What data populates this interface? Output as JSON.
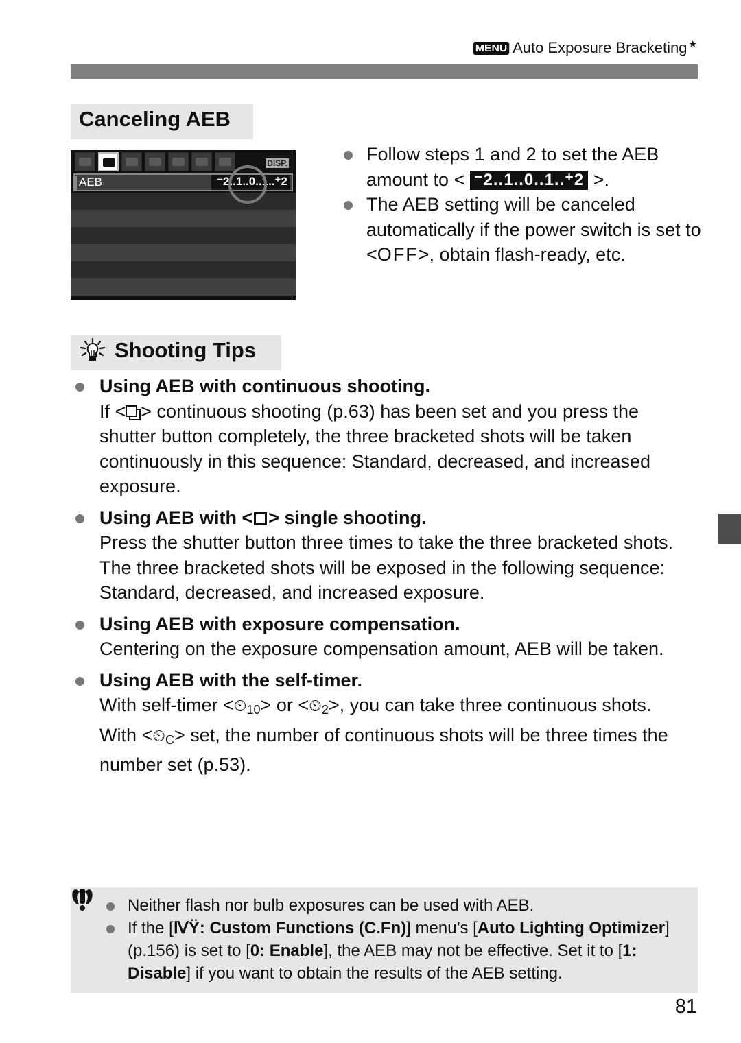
{
  "header": {
    "menu_badge": "MENU",
    "section_title": "Auto Exposure Bracketing",
    "star": "★"
  },
  "canceling": {
    "title": "Canceling AEB",
    "camera_screen": {
      "tabs": [
        "shooting-1",
        "shooting-2",
        "playback",
        "setup-1",
        "setup-2",
        "setup-3",
        "my-menu"
      ],
      "active_tab_index": 1,
      "disp_label": "DISP.",
      "menu_item": "AEB",
      "aeb_scale": "⁻2..1..0..1..⁺2"
    },
    "bullets": [
      {
        "text_before": "Follow steps 1 and 2 to set the AEB amount to < ",
        "scale": "⁻2..1..0..1..⁺2",
        "text_after": " >."
      },
      {
        "text_before": "The AEB setting will be canceled automatically if the power switch is set to <",
        "off": "OFF",
        "text_after": ">, obtain flash-ready, etc."
      }
    ]
  },
  "tips": {
    "title": "Shooting Tips",
    "items": [
      {
        "heading": "Using AEB with continuous shooting.",
        "body_before": "If <",
        "icon": "continuous-shooting-icon",
        "body_after": "> continuous shooting (p.63) has been set and you press the shutter button completely, the three bracketed shots will be taken continuously in this sequence: Standard, decreased, and increased exposure."
      },
      {
        "heading_before": "Using AEB with <",
        "icon": "single-shooting-icon",
        "heading_after": "> single shooting.",
        "body": "Press the shutter button three times to take the three bracketed shots. The three bracketed shots will be exposed in the following sequence: Standard, decreased, and increased exposure."
      },
      {
        "heading": "Using AEB with exposure compensation.",
        "body": "Centering on the exposure compensation amount, AEB will be taken."
      },
      {
        "heading": "Using AEB with the self-timer.",
        "body_1": "With self-timer <",
        "timer_a_sub": "10",
        "body_2": "> or <",
        "timer_b_sub": "2",
        "body_3": ">, you can take three continuous shots. With <",
        "timer_c_sub": "C",
        "body_4": "> set, the number of continuous shots will be three times the number set (p.53)."
      }
    ]
  },
  "caution": {
    "items": [
      {
        "text": "Neither flash nor bulb exposures can be used with AEB."
      },
      {
        "t1": "If the [",
        "b1": "Custom Functions (C.Fn)",
        "t2": "] menu’s [",
        "b2": "Auto Lighting Optimizer",
        "t3": "] (p.156) is set to [",
        "b3": "0: Enable",
        "t4": "], the AEB may not be effective. Set it to [",
        "b4": "1: Disable",
        "t5": "] if you want to obtain the results of the AEB setting."
      }
    ]
  },
  "page_number": "81",
  "colors": {
    "header_bar": "#808080",
    "title_box": "#e6e6e6",
    "bullet": "#777777",
    "side_tab": "#4d4d4d"
  }
}
